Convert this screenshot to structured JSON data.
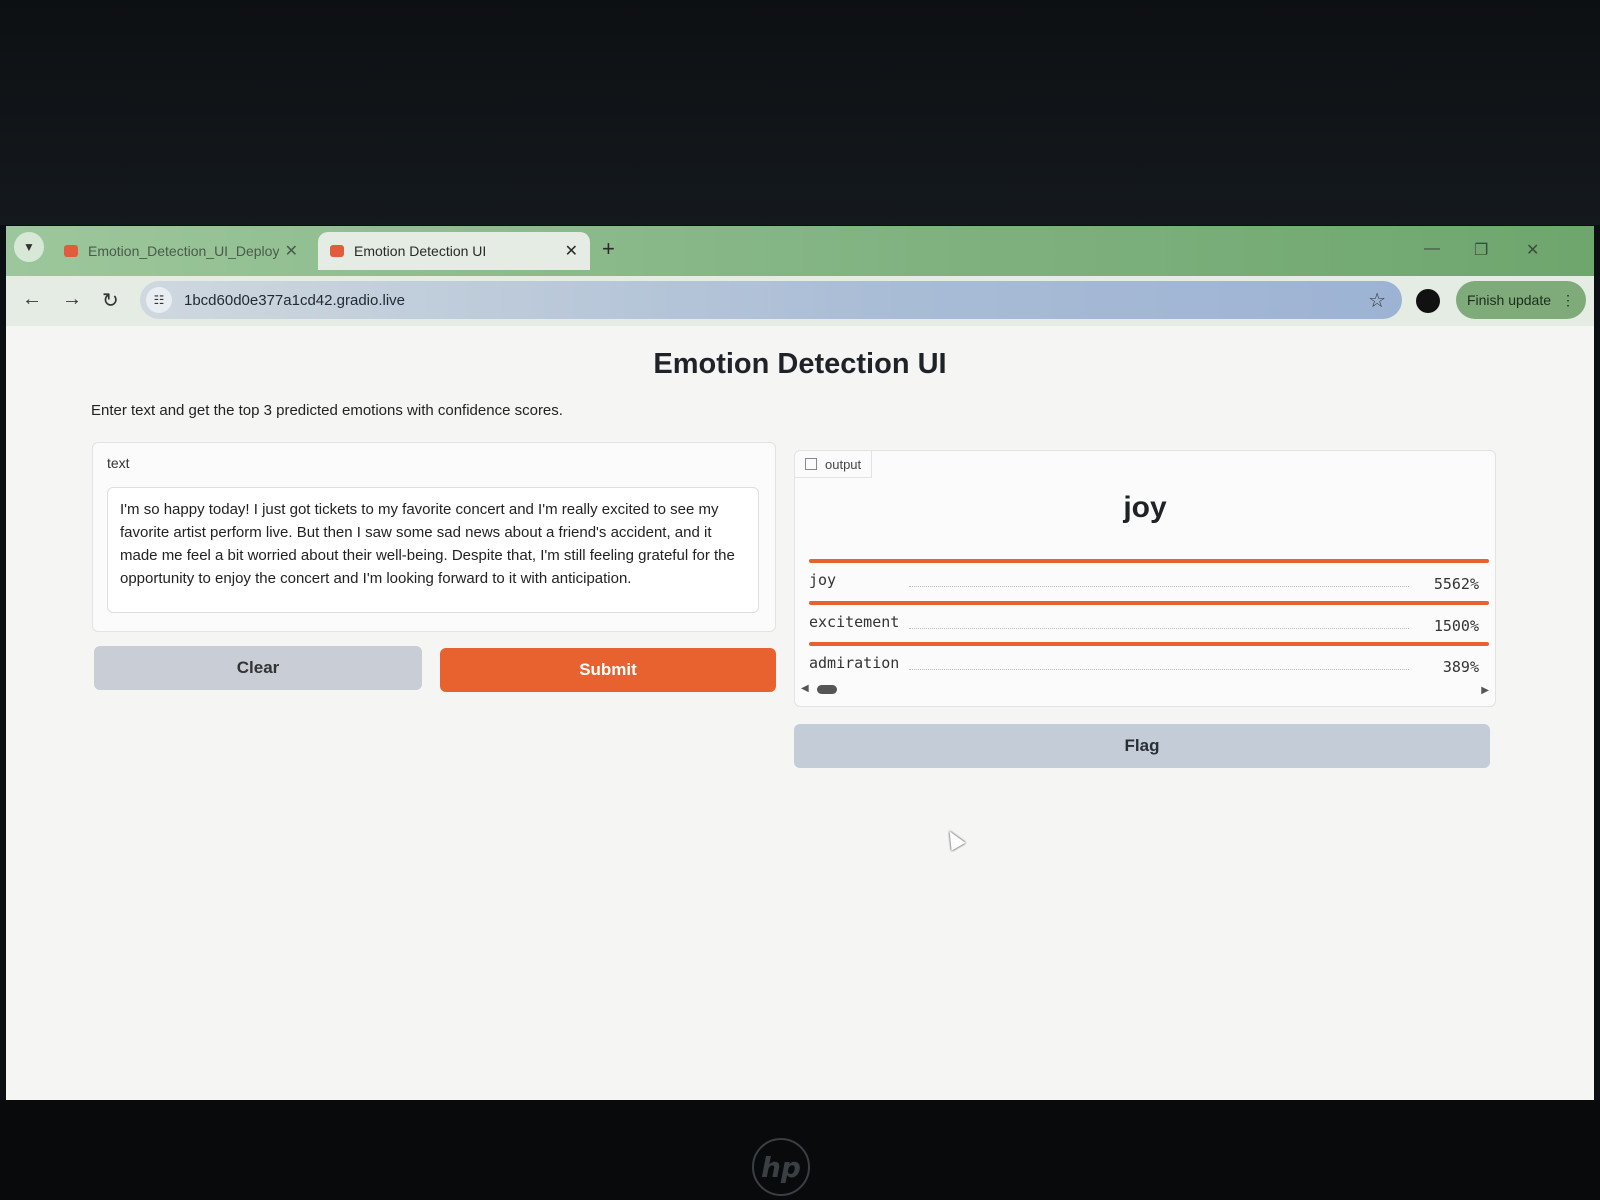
{
  "browser": {
    "tabs": [
      {
        "title": "Emotion_Detection_UI_Deploym",
        "active": false
      },
      {
        "title": "Emotion Detection UI",
        "active": true
      }
    ],
    "new_tab_icon": "plus-icon",
    "url": "1bcd60d0e377a1cd42.gradio.live",
    "update_button": "Finish update",
    "window_controls": [
      "minimize-icon",
      "restore-icon",
      "close-icon"
    ]
  },
  "app": {
    "title": "Emotion Detection UI",
    "description": "Enter text and get the top 3 predicted emotions with confidence scores.",
    "input": {
      "label": "text",
      "value": "I'm so happy today! I just got tickets to my favorite concert and I'm really excited to see my favorite artist perform live. But then I saw some sad news about a friend's accident, and it made me feel a bit worried about their well-being. Despite that, I'm still feeling grateful for the opportunity to enjoy the concert and I'm looking forward to it with anticipation."
    },
    "buttons": {
      "clear": "Clear",
      "submit": "Submit",
      "flag": "Flag"
    },
    "output": {
      "label": "output",
      "top_label": "joy",
      "confidences": [
        {
          "label": "joy",
          "value": "5562%",
          "fill": 1.0
        },
        {
          "label": "excitement",
          "value": "1500%",
          "fill": 1.0
        },
        {
          "label": "admiration",
          "value": "389%",
          "fill": 1.0
        }
      ]
    },
    "accent_color": "#e8622f"
  }
}
